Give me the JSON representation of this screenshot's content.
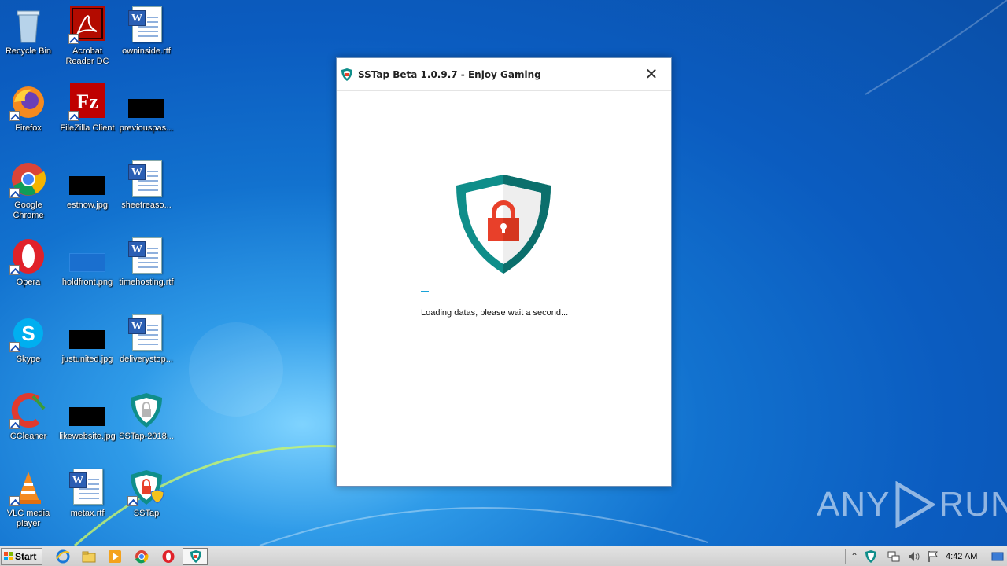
{
  "desktop": {
    "icons": [
      {
        "label": "Recycle Bin"
      },
      {
        "label": "Acrobat Reader DC"
      },
      {
        "label": "owninside.rtf"
      },
      {
        "label": "Firefox"
      },
      {
        "label": "FileZilla Client"
      },
      {
        "label": "previouspas..."
      },
      {
        "label": "Google Chrome"
      },
      {
        "label": "estnow.jpg"
      },
      {
        "label": "sheetreaso..."
      },
      {
        "label": "Opera"
      },
      {
        "label": "holdfront.png"
      },
      {
        "label": "timehosting.rtf"
      },
      {
        "label": "Skype"
      },
      {
        "label": "justunited.jpg"
      },
      {
        "label": "deliverystop..."
      },
      {
        "label": "CCleaner"
      },
      {
        "label": "likewebsite.jpg"
      },
      {
        "label": "SSTap-2018..."
      },
      {
        "label": "VLC media player"
      },
      {
        "label": "metax.rtf"
      },
      {
        "label": "SSTap"
      }
    ]
  },
  "window": {
    "title": "SSTap Beta 1.0.9.7 - Enjoy Gaming",
    "minimize_symbol": "—",
    "close_symbol": "✕",
    "loading_text": "Loading datas, please wait a second..."
  },
  "watermark": {
    "left": "ANY",
    "right": "RUN"
  },
  "taskbar": {
    "start_label": "Start",
    "clock": "4:42 AM"
  },
  "colors": {
    "shield_teal": "#0f8e8a",
    "lock_red": "#e8402a",
    "progress_blue": "#19a3d8"
  }
}
